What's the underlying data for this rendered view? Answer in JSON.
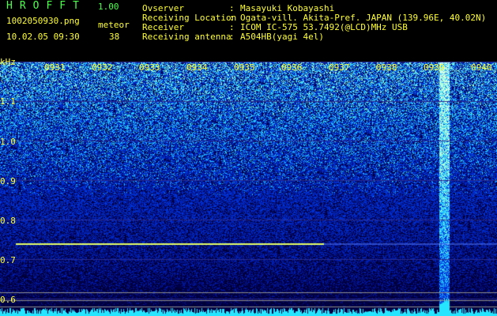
{
  "app": {
    "title": "HROFFT",
    "version": "1.00",
    "file": "1002050930.png",
    "meteor_label": "meteor",
    "datetime": "10.02.05 09:30",
    "meteor_count": "38"
  },
  "sep": ":",
  "info": [
    {
      "label": "Ovserver",
      "value": "Masayuki Kobayashi"
    },
    {
      "label": "Receiving Location",
      "value": "Ogata-vill. Akita-Pref. JAPAN (139.96E, 40.02N)"
    },
    {
      "label": "Receiver",
      "value": "ICOM IC-575 53.7492(@LCD)MHz USB"
    },
    {
      "label": "Receiving antenna",
      "value": "A504HB(yagi 4el)"
    }
  ],
  "axes": {
    "y_unit": "kHz",
    "time_ticks": [
      "0931",
      "0932",
      "0933",
      "0934",
      "0935",
      "0936",
      "0937",
      "0938",
      "0939",
      "0940"
    ],
    "freq_ticks": [
      "1.1",
      "1.0",
      "0.9",
      "0.8",
      "0.7",
      "0.6"
    ]
  },
  "colors": {
    "label": "#ffff33",
    "title": "#4cff4c",
    "tone_line": "#e6ff66",
    "baseline": "#26e6ff"
  }
}
